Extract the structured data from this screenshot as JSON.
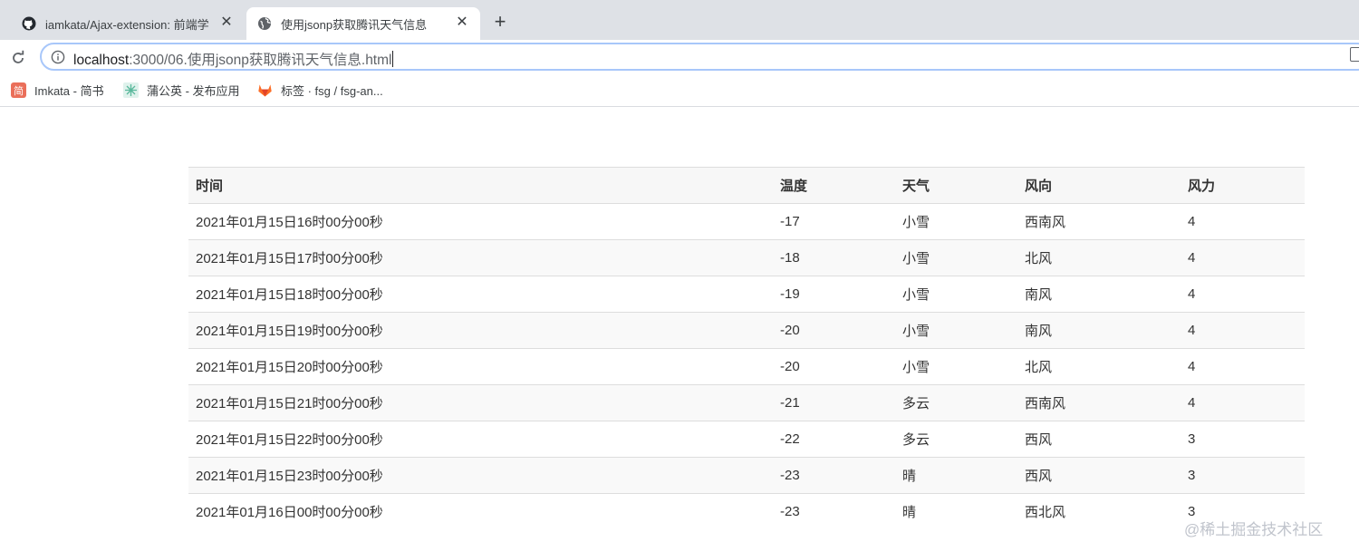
{
  "browser": {
    "tabs": [
      {
        "title": "iamkata/Ajax-extension: 前端学",
        "icon": "github-icon",
        "active": false
      },
      {
        "title": "使用jsonp获取腾讯天气信息",
        "icon": "globe-icon",
        "active": true
      }
    ],
    "close_glyph": "✕",
    "newtab_glyph": "+",
    "address": {
      "host": "localhost",
      "rest": ":3000/06.使用jsonp获取腾讯天气信息.html"
    },
    "bookmarks": [
      {
        "label": "Imkata - 简书",
        "icon": "jianshu-icon",
        "icon_text": "简",
        "color": "#ea6f5a"
      },
      {
        "label": "蒲公英 - 发布应用",
        "icon": "pgyer-icon",
        "color": "#5ab89c"
      },
      {
        "label": "标签 · fsg / fsg-an...",
        "icon": "gitlab-icon",
        "color": "#fc6d26"
      }
    ]
  },
  "table": {
    "headers": [
      "时间",
      "温度",
      "天气",
      "风向",
      "风力"
    ],
    "rows": [
      [
        "2021年01月15日16时00分00秒",
        "-17",
        "小雪",
        "西南风",
        "4"
      ],
      [
        "2021年01月15日17时00分00秒",
        "-18",
        "小雪",
        "北风",
        "4"
      ],
      [
        "2021年01月15日18时00分00秒",
        "-19",
        "小雪",
        "南风",
        "4"
      ],
      [
        "2021年01月15日19时00分00秒",
        "-20",
        "小雪",
        "南风",
        "4"
      ],
      [
        "2021年01月15日20时00分00秒",
        "-20",
        "小雪",
        "北风",
        "4"
      ],
      [
        "2021年01月15日21时00分00秒",
        "-21",
        "多云",
        "西南风",
        "4"
      ],
      [
        "2021年01月15日22时00分00秒",
        "-22",
        "多云",
        "西风",
        "3"
      ],
      [
        "2021年01月15日23时00分00秒",
        "-23",
        "晴",
        "西风",
        "3"
      ],
      [
        "2021年01月16日00时00分00秒",
        "-23",
        "晴",
        "西北风",
        "3"
      ]
    ]
  },
  "watermark": "@稀土掘金技术社区"
}
